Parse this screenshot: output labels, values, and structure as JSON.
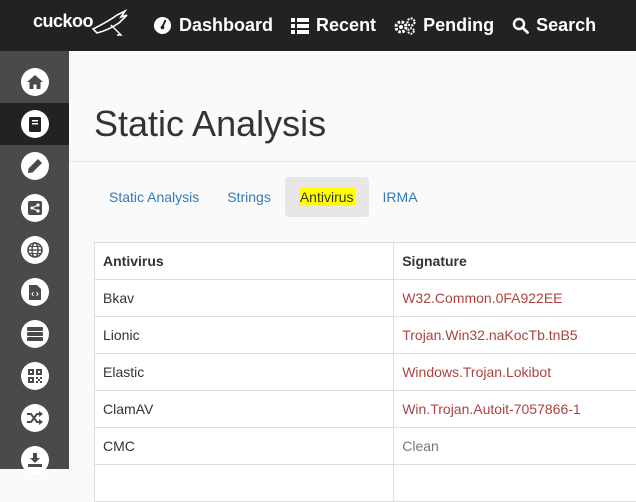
{
  "app": {
    "logo_text": "cuckoo"
  },
  "nav": [
    {
      "label": "Dashboard",
      "icon": "dashboard-icon"
    },
    {
      "label": "Recent",
      "icon": "list-icon"
    },
    {
      "label": "Pending",
      "icon": "cogs-icon"
    },
    {
      "label": "Search",
      "icon": "search-icon"
    }
  ],
  "sidebar": [
    {
      "icon": "home-icon",
      "active": false
    },
    {
      "icon": "book-icon",
      "active": true
    },
    {
      "icon": "pencil-icon",
      "active": false
    },
    {
      "icon": "share-icon",
      "active": false
    },
    {
      "icon": "globe-icon",
      "active": false
    },
    {
      "icon": "file-code-icon",
      "active": false
    },
    {
      "icon": "server-icon",
      "active": false
    },
    {
      "icon": "qrcode-icon",
      "active": false
    },
    {
      "icon": "shuffle-icon",
      "active": false
    },
    {
      "icon": "download-icon",
      "active": false
    }
  ],
  "page": {
    "title": "Static Analysis"
  },
  "tabs": [
    {
      "label": "Static Analysis",
      "active": false
    },
    {
      "label": "Strings",
      "active": false
    },
    {
      "label": "Antivirus",
      "active": true
    },
    {
      "label": "IRMA",
      "active": false
    }
  ],
  "table": {
    "headers": {
      "antivirus": "Antivirus",
      "signature": "Signature"
    },
    "rows": [
      {
        "antivirus": "Bkav",
        "signature": "W32.Common.0FA922EE",
        "detected": true
      },
      {
        "antivirus": "Lionic",
        "signature": "Trojan.Win32.naKocTb.tnB5",
        "detected": true
      },
      {
        "antivirus": "Elastic",
        "signature": "Windows.Trojan.Lokibot",
        "detected": true
      },
      {
        "antivirus": "ClamAV",
        "signature": "Win.Trojan.Autoit-7057866-1",
        "detected": true
      },
      {
        "antivirus": "CMC",
        "signature": "Clean",
        "detected": false
      },
      {
        "antivirus": "",
        "signature": "",
        "detected": false
      }
    ]
  },
  "colors": {
    "topbar": "#222222",
    "sidebar": "#4a4a4a",
    "link": "#337ab7",
    "detected": "#a94442",
    "clean": "#777777",
    "highlight": "#ffff00"
  }
}
